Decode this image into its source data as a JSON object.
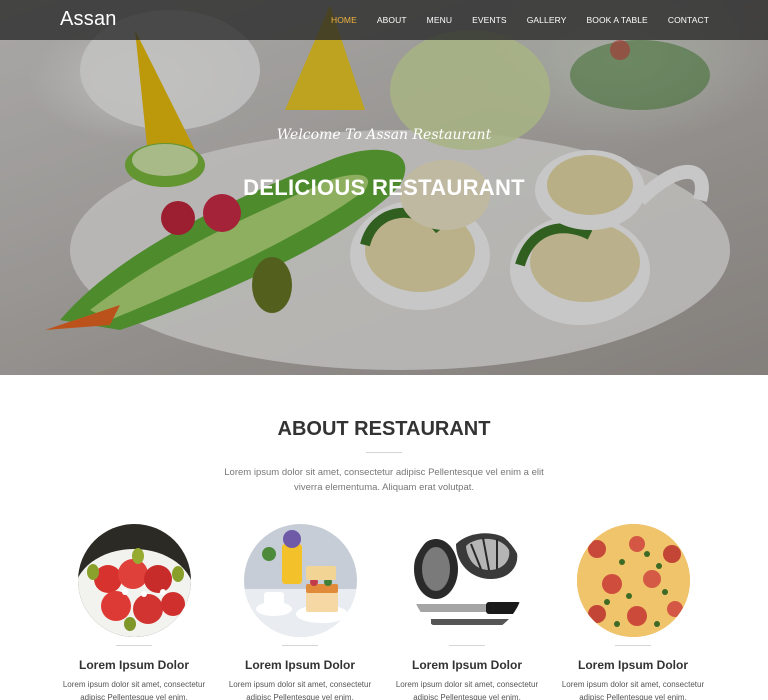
{
  "brand": {
    "logo": "Assan"
  },
  "nav": {
    "items": [
      {
        "label": "HOME",
        "active": true
      },
      {
        "label": "ABOUT",
        "active": false
      },
      {
        "label": "MENU",
        "active": false
      },
      {
        "label": "EVENTS",
        "active": false
      },
      {
        "label": "GALLERY",
        "active": false
      },
      {
        "label": "BOOK A TABLE",
        "active": false
      },
      {
        "label": "CONTACT",
        "active": false
      }
    ],
    "active_color": "#f0b43c"
  },
  "hero": {
    "welcome": "Welcome To Assan Restaurant",
    "title": "DELICIOUS RESTAURANT"
  },
  "about": {
    "title": "ABOUT RESTAURANT",
    "text": "Lorem ipsum dolor sit amet, consectetur adipisc Pellentesque vel enim a elit viverra elementuma. Aliquam erat volutpat."
  },
  "features": [
    {
      "title": "Lorem Ipsum Dolor",
      "text": "Lorem ipsum dolor sit amet, consectetur adipisc Pellentesque vel enim.",
      "image": "salad-image"
    },
    {
      "title": "Lorem Ipsum Dolor",
      "text": "Lorem ipsum dolor sit amet, consectetur adipisc Pellentesque vel enim.",
      "image": "cake-coffee-image"
    },
    {
      "title": "Lorem Ipsum Dolor",
      "text": "Lorem ipsum dolor sit amet, consectetur adipisc Pellentesque vel enim.",
      "image": "chef-knife-image"
    },
    {
      "title": "Lorem Ipsum Dolor",
      "text": "Lorem ipsum dolor sit amet, consectetur adipisc Pellentesque vel enim.",
      "image": "pizza-image"
    }
  ]
}
